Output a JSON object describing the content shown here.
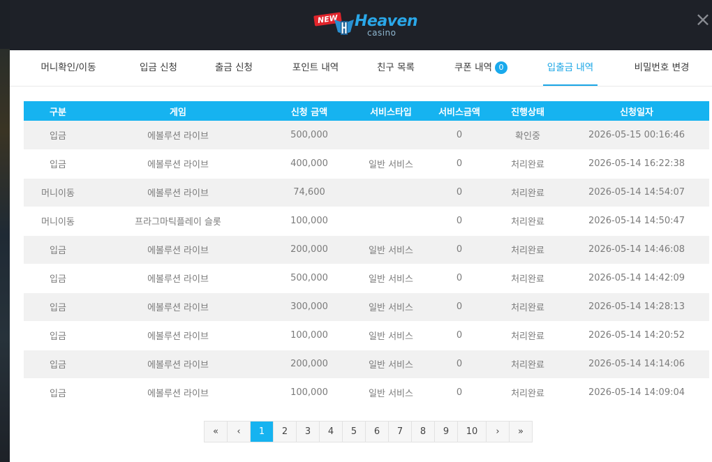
{
  "header": {
    "logo_new": "NEW",
    "logo_brand": "Heaven",
    "logo_sub": "casino",
    "close_icon": "×"
  },
  "tabs": [
    {
      "label": "머니확인/이동"
    },
    {
      "label": "입금 신청"
    },
    {
      "label": "출금 신청"
    },
    {
      "label": "포인트 내역"
    },
    {
      "label": "친구 목록"
    },
    {
      "label": "쿠폰 내역",
      "badge": "0"
    },
    {
      "label": "입출금 내역"
    },
    {
      "label": "비밀번호 변경"
    }
  ],
  "active_tab": "입출금 내역",
  "table": {
    "headers": [
      "구분",
      "게임",
      "신청 금액",
      "서비스타입",
      "서비스금액",
      "진행상태",
      "신청일자"
    ],
    "rows": [
      [
        "입금",
        "에볼루션 라이브",
        "500,000",
        "",
        "0",
        "확인중",
        "2026-05-15 00:16:46"
      ],
      [
        "입금",
        "에볼루션 라이브",
        "400,000",
        "일반 서비스",
        "0",
        "처리완료",
        "2026-05-14 16:22:38"
      ],
      [
        "머니이동",
        "에볼루션 라이브",
        "74,600",
        "",
        "0",
        "처리완료",
        "2026-05-14 14:54:07"
      ],
      [
        "머니이동",
        "프라그마틱플레이 슬롯",
        "100,000",
        "",
        "0",
        "처리완료",
        "2026-05-14 14:50:47"
      ],
      [
        "입금",
        "에볼루션 라이브",
        "200,000",
        "일반 서비스",
        "0",
        "처리완료",
        "2026-05-14 14:46:08"
      ],
      [
        "입금",
        "에볼루션 라이브",
        "500,000",
        "일반 서비스",
        "0",
        "처리완료",
        "2026-05-14 14:42:09"
      ],
      [
        "입금",
        "에볼루션 라이브",
        "300,000",
        "일반 서비스",
        "0",
        "처리완료",
        "2026-05-14 14:28:13"
      ],
      [
        "입금",
        "에볼루션 라이브",
        "100,000",
        "일반 서비스",
        "0",
        "처리완료",
        "2026-05-14 14:20:52"
      ],
      [
        "입금",
        "에볼루션 라이브",
        "200,000",
        "일반 서비스",
        "0",
        "처리완료",
        "2026-05-14 14:14:06"
      ],
      [
        "입금",
        "에볼루션 라이브",
        "100,000",
        "일반 서비스",
        "0",
        "처리완료",
        "2026-05-14 14:09:04"
      ]
    ]
  },
  "pagination": {
    "first": "«",
    "prev": "‹",
    "pages": [
      "1",
      "2",
      "3",
      "4",
      "5",
      "6",
      "7",
      "8",
      "9",
      "10"
    ],
    "current": "1",
    "next": "›",
    "last": "»"
  },
  "colors": {
    "accent": "#16b3f0",
    "header_bg": "#1e2128",
    "row_alt": "#f1f1f1",
    "brand_red": "#e0242b"
  }
}
